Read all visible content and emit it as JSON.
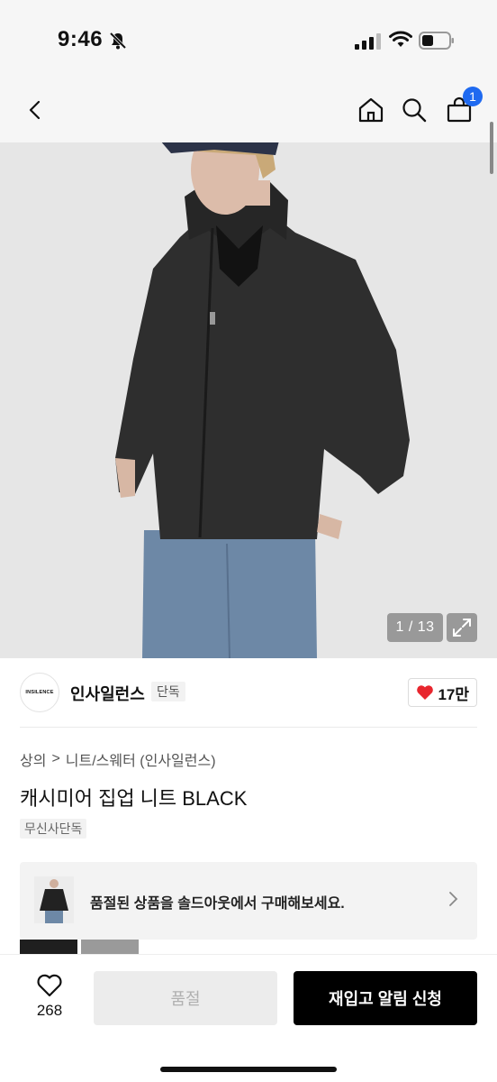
{
  "status": {
    "time": "9:46"
  },
  "nav": {
    "cart_count": "1"
  },
  "image": {
    "counter": "1 / 13",
    "model_colors": {
      "knit": "#2e2e2e",
      "jeans": "#6d88a6",
      "cap": "#2c3348",
      "background": "#e6e6e6"
    }
  },
  "brand": {
    "logo_text": "INSILENCE",
    "name": "인사일런스",
    "tag": "단독",
    "likes": "17만"
  },
  "breadcrumb": {
    "level1": "상의",
    "separator": ">",
    "level2": "니트/스웨터 (인사일런스)"
  },
  "product": {
    "title": "캐시미어 집업 니트 BLACK",
    "badge": "무신사단독"
  },
  "soldout": {
    "text": "품절된 상품을 솔드아웃에서 구매해보세요."
  },
  "bottom": {
    "wish_count": "268",
    "sold_label": "품절",
    "restock_label": "재입고 알림 신청"
  },
  "colors": {
    "accent_blue": "#1f6af0",
    "heart_red": "#e8262e",
    "primary_black": "#000000"
  }
}
